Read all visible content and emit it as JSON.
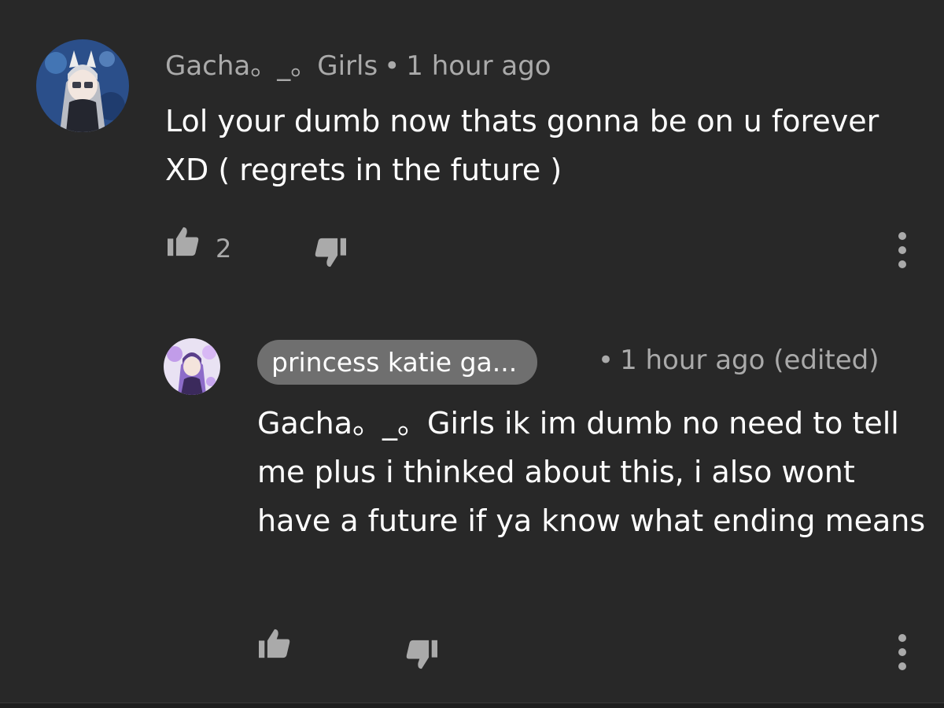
{
  "comment": {
    "author": "Gacha。_。Girls",
    "separator": "•",
    "time": "1 hour ago",
    "text": "Lol your dumb now thats gonna be on u forever XD ( regrets in the future )",
    "like_count": "2",
    "icons": {
      "like": "thumbs-up-icon",
      "dislike": "thumbs-down-icon",
      "menu": "more-vert-icon"
    }
  },
  "reply": {
    "author": "princess katie ga...",
    "separator": "•",
    "time": "1 hour ago (edited)",
    "text": "Gacha。_。Girls ik im dumb no need to tell me plus i thinked about this, i also wont have a future if ya know what ending means",
    "icons": {
      "like": "thumbs-up-icon",
      "dislike": "thumbs-down-icon",
      "menu": "more-vert-icon"
    }
  },
  "colors": {
    "background": "#282828",
    "text_primary": "#ffffff",
    "text_secondary": "#aaaaaa",
    "author_chip": "#6f6f6f"
  }
}
